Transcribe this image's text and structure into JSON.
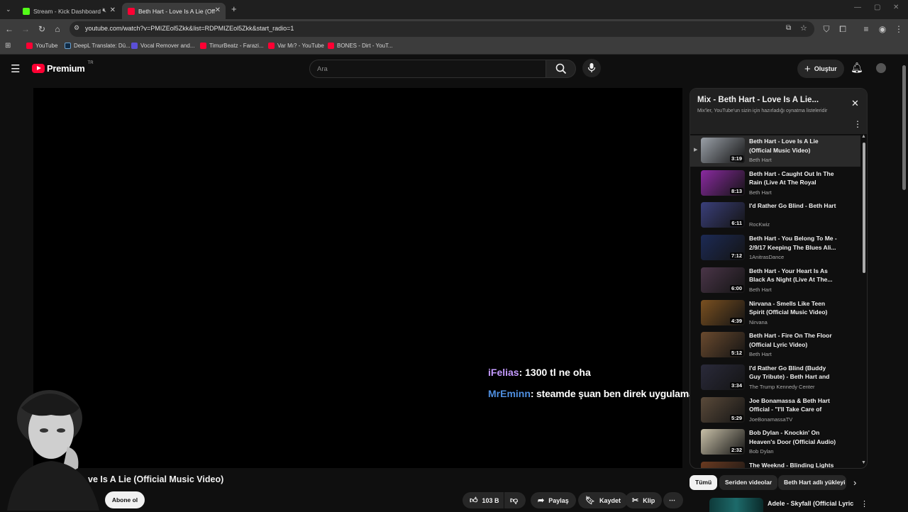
{
  "browser": {
    "tabs": [
      {
        "label": "Stream - Kick Dashboard",
        "color": "#53fc18"
      },
      {
        "label": "Beth Hart - Love Is A Lie (Officia",
        "color": "#ff0033"
      }
    ],
    "new_tab": "+",
    "url": "youtube.com/watch?v=PMIZEol5Zkk&list=RDPMIZEol5Zkk&start_radio=1",
    "bookmarks": [
      {
        "label": "YouTube",
        "color": "#ff0033"
      },
      {
        "label": "DeepL Translate: Dü...",
        "color": "#0f2b46"
      },
      {
        "label": "Vocal Remover and...",
        "color": "#5b4fd6"
      },
      {
        "label": "TimurBeatz - Farazi...",
        "color": "#ff0033"
      },
      {
        "label": "Var Mı? - YouTube",
        "color": "#ff0033"
      },
      {
        "label": "BONES - Dirt - YouT...",
        "color": "#ff0033"
      }
    ]
  },
  "header": {
    "logo_text": "Premium",
    "logo_region": "TR",
    "search_placeholder": "Ara",
    "create_label": "Oluştur"
  },
  "chat": [
    {
      "user": "iFelias",
      "user_color": "#c59bff",
      "message": ": 1300 tl ne oha"
    },
    {
      "user": "MrEminn",
      "user_color": "#4f8fe0",
      "message": ": steamde şuan ben direk uygulamadan açtım indirim gözüküyodu"
    }
  ],
  "video": {
    "title": "ve Is A Lie (Official Music Video)",
    "subscribe_label": "Abone ol",
    "likes": "103 B",
    "share_label": "Paylaş",
    "save_label": "Kaydet",
    "clip_label": "Klip"
  },
  "playlist": {
    "title": "Mix - Beth Hart - Love Is A Lie...",
    "subtitle": "Mix'ler, YouTube'un sizin için hazırladığı oynatma listeleridir",
    "items": [
      {
        "title": "Beth Hart - Love Is A Lie (Official Music Video)",
        "channel": "Beth Hart",
        "duration": "3:19",
        "thumb": "#9aa0a8"
      },
      {
        "title": "Beth Hart - Caught Out In The Rain (Live At The Royal Albert...",
        "channel": "Beth Hart",
        "duration": "8:13",
        "thumb": "#8a2aa0"
      },
      {
        "title": "I'd Rather Go Blind - Beth Hart",
        "channel": "RocKwiz",
        "duration": "6:11",
        "thumb": "#3a3f7a"
      },
      {
        "title": "Beth Hart - You Belong To Me - 2/9/17 Keeping The Blues Ali...",
        "channel": "1AnitrasDance",
        "duration": "7:12",
        "thumb": "#1c2a55"
      },
      {
        "title": "Beth Hart - Your Heart Is As Black As Night (Live At The...",
        "channel": "Beth Hart",
        "duration": "6:00",
        "thumb": "#4a3548"
      },
      {
        "title": "Nirvana - Smells Like Teen Spirit (Official Music Video)",
        "channel": "Nirvana",
        "duration": "4:39",
        "thumb": "#7a5020"
      },
      {
        "title": "Beth Hart - Fire On The Floor (Official Lyric Video)",
        "channel": "Beth Hart",
        "duration": "5:12",
        "thumb": "#6a4a2e"
      },
      {
        "title": "I'd Rather Go Blind (Buddy Guy Tribute) - Beth Hart and Jeff...",
        "channel": "The Trump Kennedy Center",
        "duration": "3:34",
        "thumb": "#2a2a3a"
      },
      {
        "title": "Joe Bonamassa & Beth Hart Official - \"I'll Take Care of You...",
        "channel": "JoeBonamassaTV",
        "duration": "5:29",
        "thumb": "#5a4a3a"
      },
      {
        "title": "Bob Dylan - Knockin' On Heaven's Door (Official Audio)",
        "channel": "Bob Dylan",
        "duration": "2:32",
        "thumb": "#c8c0a8"
      },
      {
        "title": "The Weeknd - Blinding Lights",
        "channel": "",
        "duration": "",
        "thumb": "#6a3a20"
      }
    ]
  },
  "chips": [
    "Tümü",
    "Seriden videolar",
    "Beth Hart adlı yükleyi"
  ],
  "suggested": {
    "title": "Adele - Skyfall (Official Lyric"
  }
}
